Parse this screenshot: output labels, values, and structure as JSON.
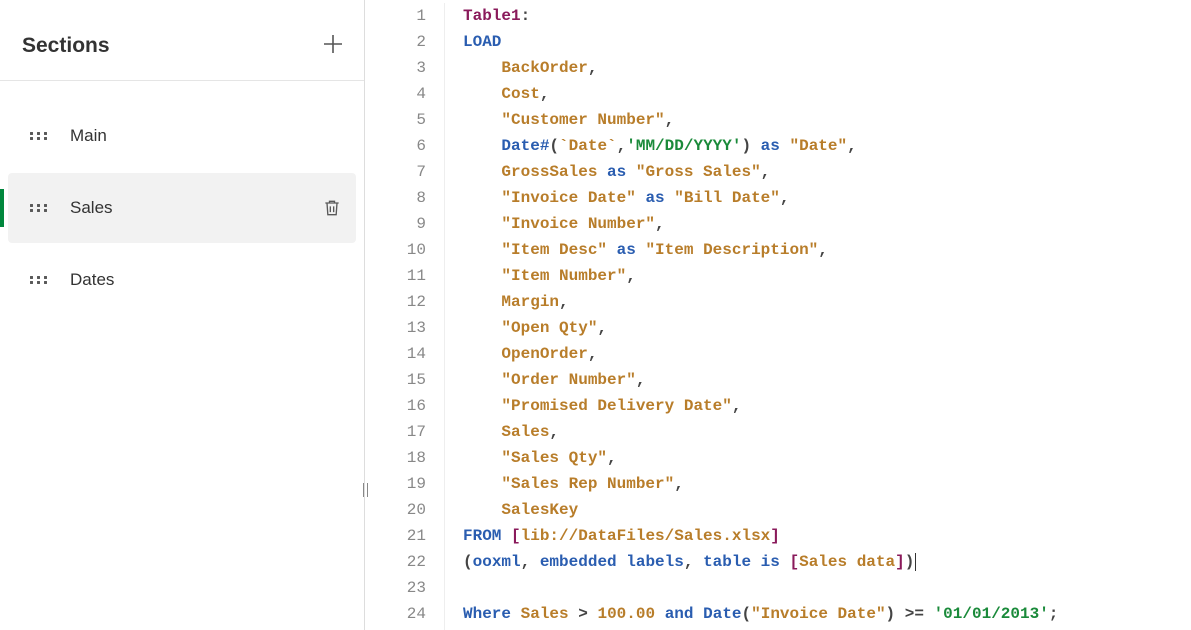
{
  "sidebar": {
    "title": "Sections",
    "items": [
      {
        "label": "Main",
        "active": false
      },
      {
        "label": "Sales",
        "active": true
      },
      {
        "label": "Dates",
        "active": false
      }
    ]
  },
  "editor": {
    "lines": [
      [
        {
          "cls": "t-tbl",
          "t": "Table1"
        },
        {
          "cls": "t-pn",
          "t": ":"
        }
      ],
      [
        {
          "cls": "t-kw",
          "t": "LOAD"
        }
      ],
      [
        {
          "cls": "",
          "t": "    "
        },
        {
          "cls": "t-id",
          "t": "BackOrder"
        },
        {
          "cls": "t-pn",
          "t": ","
        }
      ],
      [
        {
          "cls": "",
          "t": "    "
        },
        {
          "cls": "t-id",
          "t": "Cost"
        },
        {
          "cls": "t-pn",
          "t": ","
        }
      ],
      [
        {
          "cls": "",
          "t": "    "
        },
        {
          "cls": "t-str",
          "t": "\"Customer Number\""
        },
        {
          "cls": "t-pn",
          "t": ","
        }
      ],
      [
        {
          "cls": "",
          "t": "    "
        },
        {
          "cls": "t-kw",
          "t": "Date#"
        },
        {
          "cls": "t-pn",
          "t": "("
        },
        {
          "cls": "t-id",
          "t": "`Date`"
        },
        {
          "cls": "t-pn",
          "t": ","
        },
        {
          "cls": "t-sq",
          "t": "'MM/DD/YYYY'"
        },
        {
          "cls": "t-pn",
          "t": ") "
        },
        {
          "cls": "t-kw",
          "t": "as"
        },
        {
          "cls": "",
          "t": " "
        },
        {
          "cls": "t-str",
          "t": "\"Date\""
        },
        {
          "cls": "t-pn",
          "t": ","
        }
      ],
      [
        {
          "cls": "",
          "t": "    "
        },
        {
          "cls": "t-id",
          "t": "GrossSales"
        },
        {
          "cls": "",
          "t": " "
        },
        {
          "cls": "t-kw",
          "t": "as"
        },
        {
          "cls": "",
          "t": " "
        },
        {
          "cls": "t-str",
          "t": "\"Gross Sales\""
        },
        {
          "cls": "t-pn",
          "t": ","
        }
      ],
      [
        {
          "cls": "",
          "t": "    "
        },
        {
          "cls": "t-str",
          "t": "\"Invoice Date\""
        },
        {
          "cls": "",
          "t": " "
        },
        {
          "cls": "t-kw",
          "t": "as"
        },
        {
          "cls": "",
          "t": " "
        },
        {
          "cls": "t-str",
          "t": "\"Bill Date\""
        },
        {
          "cls": "t-pn",
          "t": ","
        }
      ],
      [
        {
          "cls": "",
          "t": "    "
        },
        {
          "cls": "t-str",
          "t": "\"Invoice Number\""
        },
        {
          "cls": "t-pn",
          "t": ","
        }
      ],
      [
        {
          "cls": "",
          "t": "    "
        },
        {
          "cls": "t-str",
          "t": "\"Item Desc\""
        },
        {
          "cls": "",
          "t": " "
        },
        {
          "cls": "t-kw",
          "t": "as"
        },
        {
          "cls": "",
          "t": " "
        },
        {
          "cls": "t-str",
          "t": "\"Item Description\""
        },
        {
          "cls": "t-pn",
          "t": ","
        }
      ],
      [
        {
          "cls": "",
          "t": "    "
        },
        {
          "cls": "t-str",
          "t": "\"Item Number\""
        },
        {
          "cls": "t-pn",
          "t": ","
        }
      ],
      [
        {
          "cls": "",
          "t": "    "
        },
        {
          "cls": "t-id",
          "t": "Margin"
        },
        {
          "cls": "t-pn",
          "t": ","
        }
      ],
      [
        {
          "cls": "",
          "t": "    "
        },
        {
          "cls": "t-str",
          "t": "\"Open Qty\""
        },
        {
          "cls": "t-pn",
          "t": ","
        }
      ],
      [
        {
          "cls": "",
          "t": "    "
        },
        {
          "cls": "t-id",
          "t": "OpenOrder"
        },
        {
          "cls": "t-pn",
          "t": ","
        }
      ],
      [
        {
          "cls": "",
          "t": "    "
        },
        {
          "cls": "t-str",
          "t": "\"Order Number\""
        },
        {
          "cls": "t-pn",
          "t": ","
        }
      ],
      [
        {
          "cls": "",
          "t": "    "
        },
        {
          "cls": "t-str",
          "t": "\"Promised Delivery Date\""
        },
        {
          "cls": "t-pn",
          "t": ","
        }
      ],
      [
        {
          "cls": "",
          "t": "    "
        },
        {
          "cls": "t-id",
          "t": "Sales"
        },
        {
          "cls": "t-pn",
          "t": ","
        }
      ],
      [
        {
          "cls": "",
          "t": "    "
        },
        {
          "cls": "t-str",
          "t": "\"Sales Qty\""
        },
        {
          "cls": "t-pn",
          "t": ","
        }
      ],
      [
        {
          "cls": "",
          "t": "    "
        },
        {
          "cls": "t-str",
          "t": "\"Sales Rep Number\""
        },
        {
          "cls": "t-pn",
          "t": ","
        }
      ],
      [
        {
          "cls": "",
          "t": "    "
        },
        {
          "cls": "t-id",
          "t": "SalesKey"
        }
      ],
      [
        {
          "cls": "t-kw",
          "t": "FROM"
        },
        {
          "cls": "",
          "t": " "
        },
        {
          "cls": "t-br",
          "t": "["
        },
        {
          "cls": "t-id",
          "t": "lib://DataFiles/Sales.xlsx"
        },
        {
          "cls": "t-br",
          "t": "]"
        }
      ],
      [
        {
          "cls": "t-pn",
          "t": "("
        },
        {
          "cls": "t-kw",
          "t": "ooxml"
        },
        {
          "cls": "t-pn",
          "t": ", "
        },
        {
          "cls": "t-kw",
          "t": "embedded labels"
        },
        {
          "cls": "t-pn",
          "t": ", "
        },
        {
          "cls": "t-kw",
          "t": "table is"
        },
        {
          "cls": "",
          "t": " "
        },
        {
          "cls": "t-br",
          "t": "["
        },
        {
          "cls": "t-id",
          "t": "Sales data"
        },
        {
          "cls": "t-br",
          "t": "]"
        },
        {
          "cls": "t-pn",
          "t": ")"
        },
        {
          "cls": "cursor",
          "t": ""
        }
      ],
      [],
      [
        {
          "cls": "t-kw",
          "t": "Where"
        },
        {
          "cls": "",
          "t": " "
        },
        {
          "cls": "t-id",
          "t": "Sales"
        },
        {
          "cls": "",
          "t": " "
        },
        {
          "cls": "t-pn",
          "t": ">"
        },
        {
          "cls": "",
          "t": " "
        },
        {
          "cls": "t-id",
          "t": "100.00"
        },
        {
          "cls": "",
          "t": " "
        },
        {
          "cls": "t-kw",
          "t": "and"
        },
        {
          "cls": "",
          "t": " "
        },
        {
          "cls": "t-kw",
          "t": "Date"
        },
        {
          "cls": "t-pn",
          "t": "("
        },
        {
          "cls": "t-str",
          "t": "\"Invoice Date\""
        },
        {
          "cls": "t-pn",
          "t": ")"
        },
        {
          "cls": "",
          "t": " "
        },
        {
          "cls": "t-pn",
          "t": ">="
        },
        {
          "cls": "",
          "t": " "
        },
        {
          "cls": "t-sq",
          "t": "'01/01/2013'"
        },
        {
          "cls": "t-pn",
          "t": ";"
        }
      ]
    ]
  }
}
